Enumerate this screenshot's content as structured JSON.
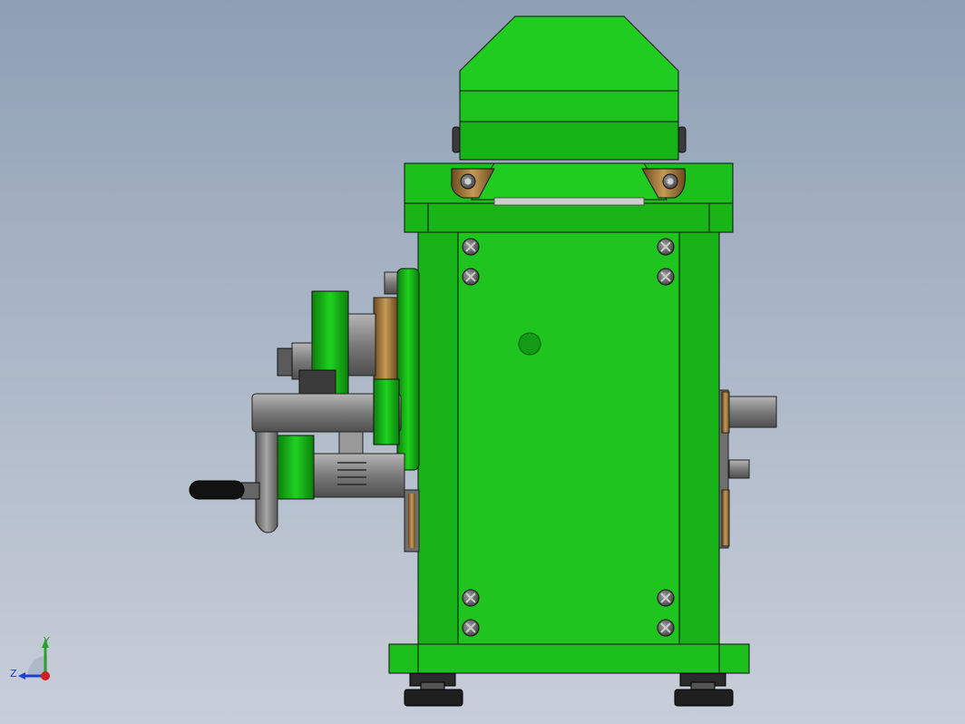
{
  "scene": {
    "model_color": "#1fbf1f",
    "model_dark_color": "#0f8f0f",
    "steel_color": "#8c8c8c",
    "bronze_color": "#a07a3a",
    "foot_color": "#1e1e1e",
    "handle_color": "#111111"
  },
  "triad": {
    "y_label": "Y",
    "z_label": "Z",
    "y_axis_color": "#2ca02c",
    "z_axis_color": "#1f3fcf",
    "x_axis_color": "#d02020"
  }
}
